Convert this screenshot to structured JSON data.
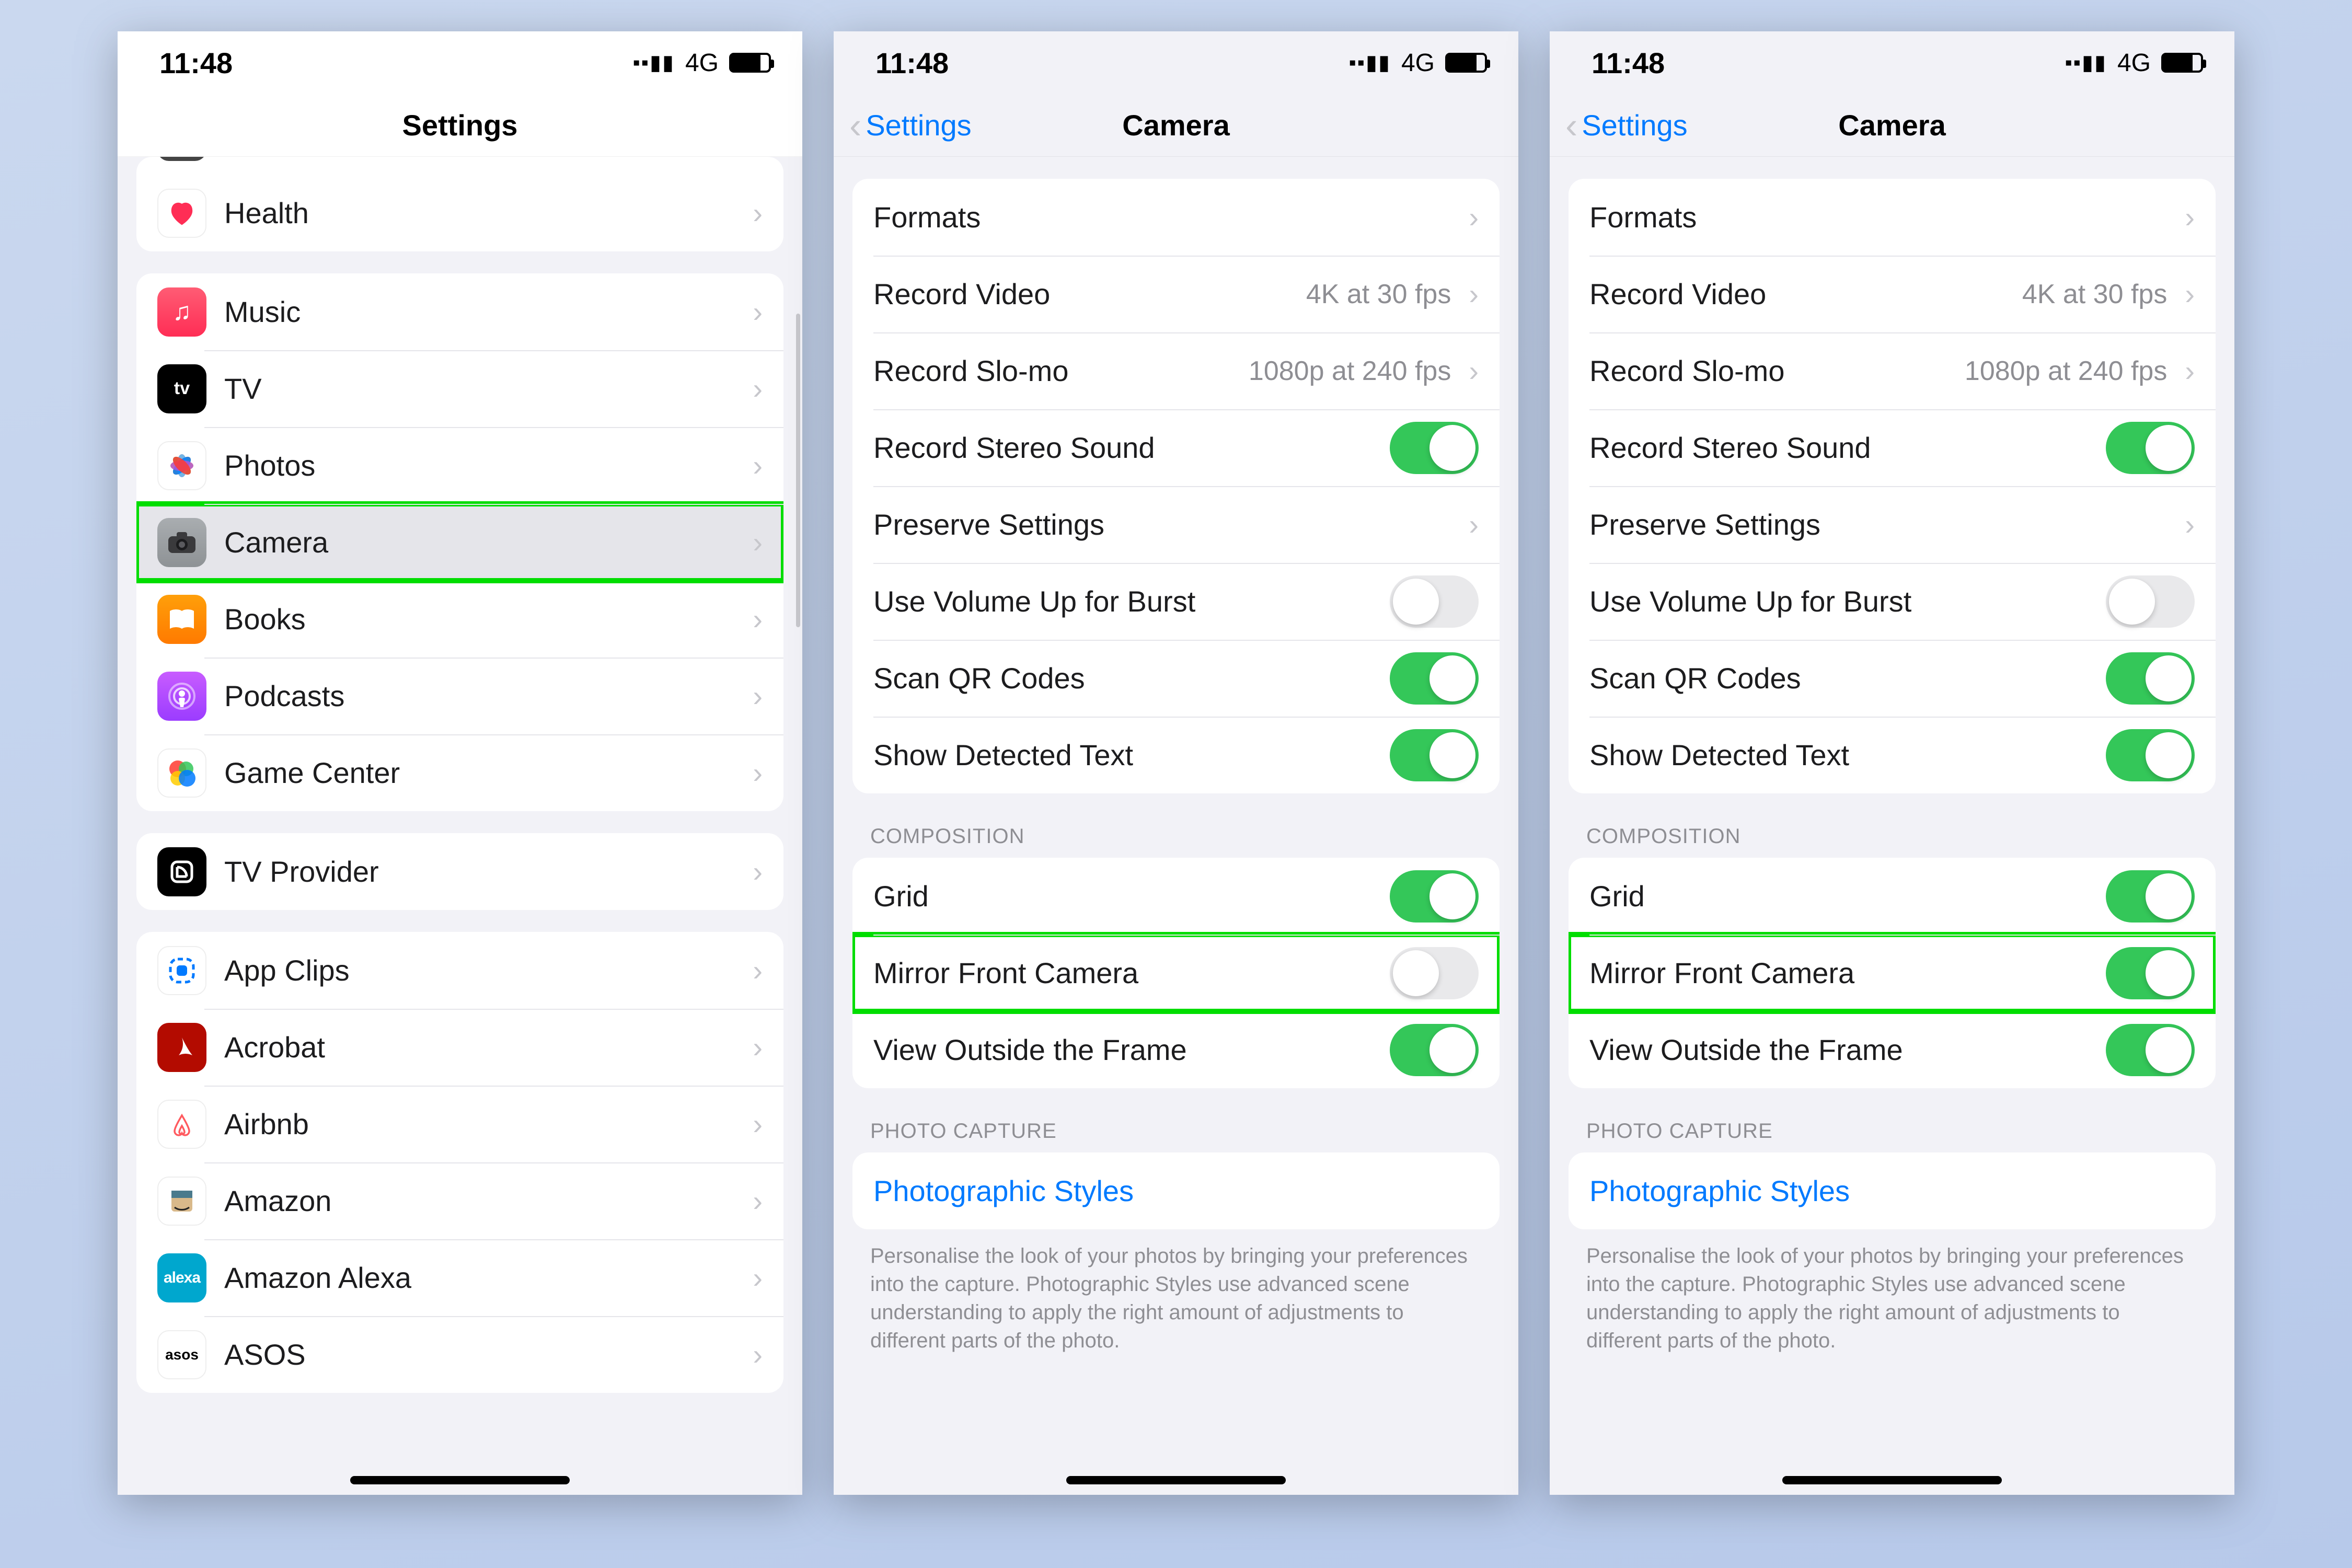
{
  "status": {
    "time": "11:48",
    "network": "4G"
  },
  "screen1": {
    "navTitle": "Settings",
    "peek": {
      "label": ""
    },
    "group0": [
      {
        "id": "health",
        "label": "Health"
      }
    ],
    "group1": [
      {
        "id": "music",
        "label": "Music"
      },
      {
        "id": "tv",
        "label": "TV"
      },
      {
        "id": "photos",
        "label": "Photos"
      },
      {
        "id": "camera",
        "label": "Camera",
        "selected": true,
        "highlighted": true
      },
      {
        "id": "books",
        "label": "Books"
      },
      {
        "id": "podcasts",
        "label": "Podcasts"
      },
      {
        "id": "gamecenter",
        "label": "Game Center"
      }
    ],
    "group2": [
      {
        "id": "tvprovider",
        "label": "TV Provider"
      }
    ],
    "group3": [
      {
        "id": "appclips",
        "label": "App Clips"
      },
      {
        "id": "acrobat",
        "label": "Acrobat"
      },
      {
        "id": "airbnb",
        "label": "Airbnb"
      },
      {
        "id": "amazon",
        "label": "Amazon"
      },
      {
        "id": "alexa",
        "label": "Amazon Alexa"
      },
      {
        "id": "asos",
        "label": "ASOS"
      }
    ]
  },
  "cameraScreen": {
    "back": "Settings",
    "title": "Camera",
    "section1": [
      {
        "id": "formats",
        "label": "Formats",
        "type": "link"
      },
      {
        "id": "recvideo",
        "label": "Record Video",
        "value": "4K at 30 fps",
        "type": "link"
      },
      {
        "id": "recslomo",
        "label": "Record Slo-mo",
        "value": "1080p at 240 fps",
        "type": "link"
      },
      {
        "id": "stereo",
        "label": "Record Stereo Sound",
        "type": "toggle",
        "on": true
      },
      {
        "id": "preserve",
        "label": "Preserve Settings",
        "type": "link"
      },
      {
        "id": "volup",
        "label": "Use Volume Up for Burst",
        "type": "toggle",
        "on": false
      },
      {
        "id": "qr",
        "label": "Scan QR Codes",
        "type": "toggle",
        "on": true
      },
      {
        "id": "detected",
        "label": "Show Detected Text",
        "type": "toggle",
        "on": true
      }
    ],
    "compHdr": "Composition",
    "photoHdr": "Photo Capture",
    "section2": [
      {
        "id": "grid",
        "label": "Grid",
        "type": "toggle",
        "on": true
      },
      {
        "id": "mirror",
        "label": "Mirror Front Camera",
        "type": "toggle",
        "highlighted": true
      },
      {
        "id": "viewoutside",
        "label": "View Outside the Frame",
        "type": "toggle",
        "on": true
      }
    ],
    "section3": [
      {
        "id": "styles",
        "label": "Photographic Styles",
        "type": "styles"
      }
    ],
    "footer": "Personalise the look of your photos by bringing your preferences into the capture. Photographic Styles use advanced scene understanding to apply the right amount of adjustments to different parts of the photo."
  },
  "mirrorStates": {
    "screen2": false,
    "screen3": true
  }
}
